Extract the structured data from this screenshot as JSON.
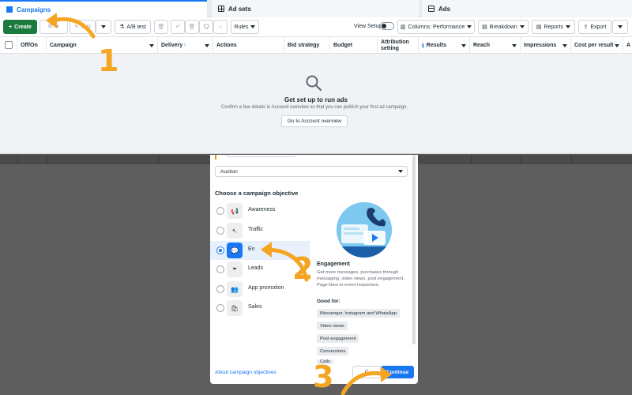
{
  "tabs": [
    {
      "label": "Campaigns",
      "icon": "campaigns-icon"
    },
    {
      "label": "Ad sets",
      "icon": "adsets-icon"
    },
    {
      "label": "Ads",
      "icon": "ads-icon"
    }
  ],
  "toolbar": {
    "create_label": "Create",
    "edit_label": "Edit",
    "ab_test_label": "A/B test",
    "rules_label": "Rules",
    "view_setup_label": "View Setup",
    "columns_label": "Columns: Performance",
    "breakdown_label": "Breakdown",
    "reports_label": "Reports",
    "export_label": "Export"
  },
  "table": {
    "columns": [
      "Off/On",
      "Campaign",
      "Delivery",
      "Actions",
      "Bid strategy",
      "Budget",
      "Attribution setting",
      "Results",
      "Reach",
      "Impressions",
      "Cost per result",
      "A"
    ],
    "delivery_sort_glyph": "↑"
  },
  "empty_state": {
    "title": "Get set up to run ads",
    "subtitle": "Confirm a few details in Account overview so that you can publish your first ad campaign.",
    "button": "Go to Account overview"
  },
  "modal": {
    "buying_type": "Auction",
    "objective_title": "Choose a campaign objective",
    "options": [
      {
        "label": "Awareness",
        "icon": "megaphone-icon",
        "glyph": "📢",
        "selected": false
      },
      {
        "label": "Traffic",
        "icon": "cursor-icon",
        "glyph": "↖",
        "selected": false
      },
      {
        "label": "En",
        "icon": "chat-bubbles-icon",
        "glyph": "💬",
        "selected": true
      },
      {
        "label": "Leads",
        "icon": "filter-icon",
        "glyph": "⏷",
        "selected": false
      },
      {
        "label": "App promotion",
        "icon": "people-icon",
        "glyph": "👥",
        "selected": false
      },
      {
        "label": "Sales",
        "icon": "shopping-bag-icon",
        "glyph": "🛍",
        "selected": false
      }
    ],
    "detail": {
      "title": "Engagement",
      "description": "Get more messages, purchases through messaging, video views, post engagement, Page likes or event responses.",
      "good_for_label": "Good for:",
      "good_for": [
        "Messenger, Instagram and WhatsApp",
        "Video views",
        "Post engagement",
        "Conversions",
        "Calls"
      ]
    },
    "about_link": "About campaign objectives",
    "cancel_label": "C",
    "continue_label": "Continue"
  },
  "annotations": [
    "1",
    "2",
    "3"
  ],
  "colors": {
    "accent": "#1877f2",
    "create_green": "#1b7a3e",
    "annotation_orange": "#f4a623"
  }
}
